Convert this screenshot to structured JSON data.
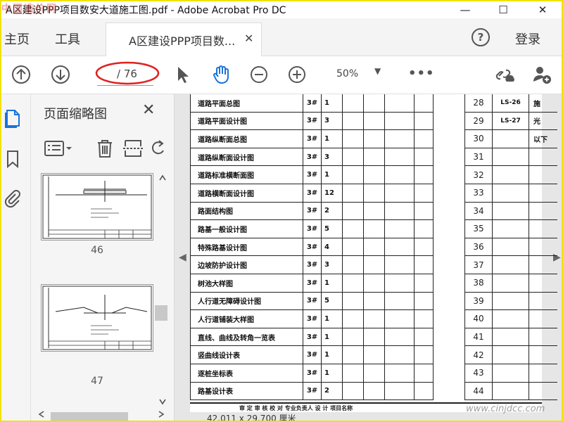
{
  "window": {
    "title": "A区建设PPP项目数安大道施工图.pdf - Adobe Acrobat Pro DC",
    "watermark": "中国造价网",
    "minimize": "—",
    "maximize": "☐",
    "close": "✕"
  },
  "nav": {
    "home": "主页",
    "tools": "工具",
    "tab_label": "A区建设PPP项目数...",
    "tab_close": "✕",
    "help": "?",
    "login": "登录"
  },
  "toolbar": {
    "page_current": "",
    "page_total": "/ 76",
    "zoom": "50%",
    "zoom_caret": "▼",
    "more": "•••"
  },
  "panel": {
    "title": "页面缩略图",
    "close": "✕",
    "thumbnails": [
      {
        "page": "46"
      },
      {
        "page": "47"
      }
    ]
  },
  "document": {
    "rows": [
      {
        "name": "道路平面总图",
        "size": "3#",
        "count": "1"
      },
      {
        "name": "道路平面设计图",
        "size": "3#",
        "count": "3"
      },
      {
        "name": "道路纵断面总图",
        "size": "3#",
        "count": "1"
      },
      {
        "name": "道路纵断面设计图",
        "size": "3#",
        "count": "3"
      },
      {
        "name": "道路标准横断面图",
        "size": "3#",
        "count": "1"
      },
      {
        "name": "道路横断面设计图",
        "size": "3#",
        "count": "12"
      },
      {
        "name": "路面结构图",
        "size": "3#",
        "count": "2"
      },
      {
        "name": "路基一般设计图",
        "size": "3#",
        "count": "5"
      },
      {
        "name": "特殊路基设计图",
        "size": "3#",
        "count": "4"
      },
      {
        "name": "边坡防护设计图",
        "size": "3#",
        "count": "3"
      },
      {
        "name": "树池大样图",
        "size": "3#",
        "count": "1"
      },
      {
        "name": "人行道无障碍设计图",
        "size": "3#",
        "count": "5"
      },
      {
        "name": "人行道铺装大样图",
        "size": "3#",
        "count": "1"
      },
      {
        "name": "直线、曲线及转角一览表",
        "size": "3#",
        "count": "1"
      },
      {
        "name": "竖曲线设计表",
        "size": "3#",
        "count": "1"
      },
      {
        "name": "逐桩坐标表",
        "size": "3#",
        "count": "1"
      },
      {
        "name": "路基设计表",
        "size": "3#",
        "count": "2"
      }
    ],
    "right_rows": [
      {
        "num": "28",
        "code": "LS-26",
        "extra": "施"
      },
      {
        "num": "29",
        "code": "LS-27",
        "extra": "光"
      },
      {
        "num": "30",
        "code": "",
        "extra": "以下"
      },
      {
        "num": "31",
        "code": "",
        "extra": ""
      },
      {
        "num": "32",
        "code": "",
        "extra": ""
      },
      {
        "num": "33",
        "code": "",
        "extra": ""
      },
      {
        "num": "34",
        "code": "",
        "extra": ""
      },
      {
        "num": "35",
        "code": "",
        "extra": ""
      },
      {
        "num": "36",
        "code": "",
        "extra": ""
      },
      {
        "num": "37",
        "code": "",
        "extra": ""
      },
      {
        "num": "38",
        "code": "",
        "extra": ""
      },
      {
        "num": "39",
        "code": "",
        "extra": ""
      },
      {
        "num": "40",
        "code": "",
        "extra": ""
      },
      {
        "num": "41",
        "code": "",
        "extra": ""
      },
      {
        "num": "42",
        "code": "",
        "extra": ""
      },
      {
        "num": "43",
        "code": "",
        "extra": ""
      },
      {
        "num": "44",
        "code": "",
        "extra": ""
      }
    ],
    "footer_text": "审  定   审 核   校 对   专业负责人   设 计   项目名称",
    "page_size": "42.011 x 29.700 厘米",
    "site_watermark": "www.cinjdcc.com"
  }
}
